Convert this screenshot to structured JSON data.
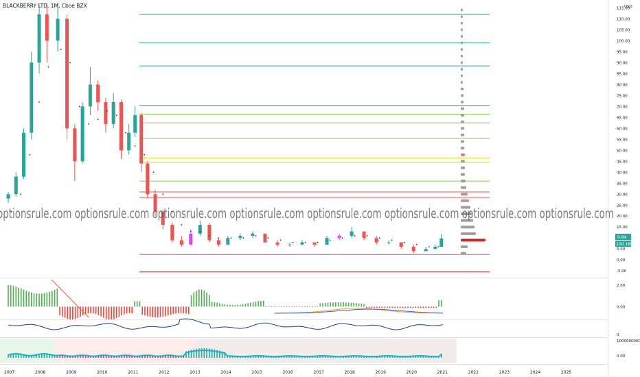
{
  "chart_data": [
    {
      "type": "candlestick",
      "title": "BLACKBERRY LTD, 1M, Cboe BZX",
      "currency": "USD",
      "ylim": [
        -6.5,
        117
      ],
      "y_ticks": [
        -5,
        0,
        5,
        10,
        15,
        20,
        25,
        30,
        35,
        40,
        45,
        50,
        55,
        60,
        65,
        70,
        75,
        80,
        85,
        90,
        95,
        100,
        105,
        110,
        115
      ],
      "x_ticks": [
        "2007",
        "2008",
        "2009",
        "2010",
        "2011",
        "2012",
        "2013",
        "2014",
        "2015",
        "2016",
        "2017",
        "2018",
        "2019",
        "2020",
        "2021",
        "2022",
        "2023",
        "2024",
        "2025"
      ],
      "watermark": "optionsrule.com optionsrule.com optionsrule.com optionsrule.com optionsrule.com optionsrule.com optionsrule.com optionsrule.com",
      "last_price": "9.84",
      "countdown": "10d 18h",
      "colors": {
        "up": "#26a69a",
        "down": "#ef5350",
        "pink": "#e040fb",
        "dots": "#333333"
      },
      "bars": [
        {
          "t": 2007.0,
          "o": 28,
          "h": 31,
          "l": 26,
          "c": 30
        },
        {
          "t": 2007.25,
          "o": 30,
          "h": 40,
          "l": 29,
          "c": 38
        },
        {
          "t": 2007.5,
          "o": 38,
          "h": 60,
          "l": 37,
          "c": 58
        },
        {
          "t": 2007.75,
          "o": 58,
          "h": 95,
          "l": 55,
          "c": 90
        },
        {
          "t": 2008.0,
          "o": 90,
          "h": 117,
          "l": 85,
          "c": 112
        },
        {
          "t": 2008.25,
          "o": 112,
          "h": 117,
          "l": 90,
          "c": 100
        },
        {
          "t": 2008.6,
          "o": 100,
          "h": 117,
          "l": 95,
          "c": 110
        },
        {
          "t": 2008.9,
          "o": 110,
          "h": 112,
          "l": 55,
          "c": 60
        },
        {
          "t": 2009.15,
          "o": 60,
          "h": 62,
          "l": 36,
          "c": 45
        },
        {
          "t": 2009.4,
          "o": 45,
          "h": 72,
          "l": 44,
          "c": 70
        },
        {
          "t": 2009.65,
          "o": 70,
          "h": 88,
          "l": 66,
          "c": 80
        },
        {
          "t": 2009.9,
          "o": 80,
          "h": 82,
          "l": 68,
          "c": 72
        },
        {
          "t": 2010.15,
          "o": 72,
          "h": 74,
          "l": 58,
          "c": 62
        },
        {
          "t": 2010.4,
          "o": 62,
          "h": 76,
          "l": 60,
          "c": 72
        },
        {
          "t": 2010.65,
          "o": 72,
          "h": 73,
          "l": 46,
          "c": 50
        },
        {
          "t": 2010.9,
          "o": 50,
          "h": 62,
          "l": 48,
          "c": 58
        },
        {
          "t": 2011.1,
          "o": 58,
          "h": 70,
          "l": 56,
          "c": 66
        },
        {
          "t": 2011.3,
          "o": 66,
          "h": 67,
          "l": 40,
          "c": 44
        },
        {
          "t": 2011.5,
          "o": 44,
          "h": 45,
          "l": 28,
          "c": 30
        },
        {
          "t": 2011.75,
          "o": 30,
          "h": 32,
          "l": 20,
          "c": 22
        },
        {
          "t": 2012.0,
          "o": 22,
          "h": 23,
          "l": 14,
          "c": 16
        },
        {
          "t": 2012.3,
          "o": 16,
          "h": 17,
          "l": 8,
          "c": 9
        },
        {
          "t": 2012.6,
          "o": 9,
          "h": 11,
          "l": 6,
          "c": 7
        },
        {
          "t": 2012.9,
          "o": 7,
          "h": 14,
          "l": 7,
          "c": 12
        },
        {
          "t": 2013.2,
          "o": 12,
          "h": 18,
          "l": 11,
          "c": 16
        },
        {
          "t": 2013.5,
          "o": 16,
          "h": 17,
          "l": 8,
          "c": 9
        },
        {
          "t": 2013.8,
          "o": 9,
          "h": 10,
          "l": 6,
          "c": 7
        },
        {
          "t": 2014.1,
          "o": 7,
          "h": 11,
          "l": 7,
          "c": 10
        },
        {
          "t": 2014.5,
          "o": 10,
          "h": 12,
          "l": 9,
          "c": 11
        },
        {
          "t": 2014.9,
          "o": 11,
          "h": 13,
          "l": 10,
          "c": 12
        },
        {
          "t": 2015.3,
          "o": 12,
          "h": 12,
          "l": 8,
          "c": 8
        },
        {
          "t": 2015.7,
          "o": 8,
          "h": 9,
          "l": 6,
          "c": 7
        },
        {
          "t": 2016.1,
          "o": 7,
          "h": 8,
          "l": 6,
          "c": 7
        },
        {
          "t": 2016.5,
          "o": 7,
          "h": 9,
          "l": 7,
          "c": 8
        },
        {
          "t": 2016.9,
          "o": 8,
          "h": 8,
          "l": 6,
          "c": 7
        },
        {
          "t": 2017.3,
          "o": 7,
          "h": 11,
          "l": 7,
          "c": 10
        },
        {
          "t": 2017.7,
          "o": 10,
          "h": 12,
          "l": 9,
          "c": 11
        },
        {
          "t": 2018.1,
          "o": 11,
          "h": 15,
          "l": 10,
          "c": 13
        },
        {
          "t": 2018.5,
          "o": 13,
          "h": 13,
          "l": 9,
          "c": 10
        },
        {
          "t": 2018.9,
          "o": 10,
          "h": 11,
          "l": 7,
          "c": 8
        },
        {
          "t": 2019.3,
          "o": 8,
          "h": 9,
          "l": 7,
          "c": 8
        },
        {
          "t": 2019.7,
          "o": 8,
          "h": 8,
          "l": 5,
          "c": 6
        },
        {
          "t": 2020.1,
          "o": 6,
          "h": 7,
          "l": 3,
          "c": 4
        },
        {
          "t": 2020.5,
          "o": 4,
          "h": 6,
          "l": 4,
          "c": 5
        },
        {
          "t": 2020.8,
          "o": 5,
          "h": 7,
          "l": 5,
          "c": 6
        },
        {
          "t": 2021.0,
          "o": 6,
          "h": 12,
          "l": 6,
          "c": 9.84
        }
      ],
      "level_lines": [
        {
          "y": 112,
          "color": "#26a69a"
        },
        {
          "y": 99,
          "color": "#26a69a"
        },
        {
          "y": 88.5,
          "color": "#26a69a"
        },
        {
          "y": 70.5,
          "color": "#26a69a"
        },
        {
          "y": 66.5,
          "color": "#8bc34a"
        },
        {
          "y": 62.5,
          "color": "#8bc34a"
        },
        {
          "y": 55.5,
          "color": "#8bc34a"
        },
        {
          "y": 46.5,
          "color": "#cddc39"
        },
        {
          "y": 44.5,
          "color": "#cddc39"
        },
        {
          "y": 36,
          "color": "#8bc34a"
        },
        {
          "y": 31,
          "color": "#ef5350"
        },
        {
          "y": 28.5,
          "color": "#ef5350"
        },
        {
          "y": 2.5,
          "color": "#ef5350"
        },
        {
          "y": -5.5,
          "color": "#b71c1c"
        }
      ],
      "volume_profile": [
        {
          "y": 114,
          "w": 3,
          "color": "#9e9e9e"
        },
        {
          "y": 111,
          "w": 3,
          "color": "#9e9e9e"
        },
        {
          "y": 108,
          "w": 3,
          "color": "#9e9e9e"
        },
        {
          "y": 105,
          "w": 3,
          "color": "#9e9e9e"
        },
        {
          "y": 102,
          "w": 3,
          "color": "#9e9e9e"
        },
        {
          "y": 99,
          "w": 3,
          "color": "#9e9e9e"
        },
        {
          "y": 96,
          "w": 3,
          "color": "#9e9e9e"
        },
        {
          "y": 93,
          "w": 3,
          "color": "#9e9e9e"
        },
        {
          "y": 90,
          "w": 3,
          "color": "#9e9e9e"
        },
        {
          "y": 87,
          "w": 3,
          "color": "#9e9e9e"
        },
        {
          "y": 84,
          "w": 3,
          "color": "#9e9e9e"
        },
        {
          "y": 81,
          "w": 3,
          "color": "#9e9e9e"
        },
        {
          "y": 78,
          "w": 4,
          "color": "#9e9e9e"
        },
        {
          "y": 75,
          "w": 4,
          "color": "#9e9e9e"
        },
        {
          "y": 72,
          "w": 4,
          "color": "#9e9e9e"
        },
        {
          "y": 69,
          "w": 5,
          "color": "#9e9e9e"
        },
        {
          "y": 66,
          "w": 5,
          "color": "#9e9e9e"
        },
        {
          "y": 63,
          "w": 5,
          "color": "#9e9e9e"
        },
        {
          "y": 60,
          "w": 5,
          "color": "#9e9e9e"
        },
        {
          "y": 57,
          "w": 5,
          "color": "#9e9e9e"
        },
        {
          "y": 54,
          "w": 5,
          "color": "#9e9e9e"
        },
        {
          "y": 51,
          "w": 5,
          "color": "#9e9e9e"
        },
        {
          "y": 48,
          "w": 6,
          "color": "#e57373"
        },
        {
          "y": 45,
          "w": 6,
          "color": "#9e9e9e"
        },
        {
          "y": 42,
          "w": 6,
          "color": "#9e9e9e"
        },
        {
          "y": 39,
          "w": 6,
          "color": "#9e9e9e"
        },
        {
          "y": 36,
          "w": 7,
          "color": "#9e9e9e"
        },
        {
          "y": 33,
          "w": 8,
          "color": "#9e9e9e"
        },
        {
          "y": 30,
          "w": 10,
          "color": "#9e9e9e"
        },
        {
          "y": 27,
          "w": 12,
          "color": "#9e9e9e"
        },
        {
          "y": 24,
          "w": 14,
          "color": "#9e9e9e"
        },
        {
          "y": 21,
          "w": 16,
          "color": "#9e9e9e"
        },
        {
          "y": 18,
          "w": 18,
          "color": "#9e9e9e"
        },
        {
          "y": 15,
          "w": 20,
          "color": "#9e9e9e"
        },
        {
          "y": 12,
          "w": 22,
          "color": "#9e9e9e"
        },
        {
          "y": 9,
          "w": 36,
          "color": "#c62828"
        },
        {
          "y": 6,
          "w": 10,
          "color": "#9e9e9e"
        },
        {
          "y": 3,
          "w": 8,
          "color": "#9e9e9e"
        }
      ]
    },
    {
      "type": "histogram",
      "ylim": [
        -1,
        2.5
      ],
      "y_ticks": [
        "2.00",
        "0.00"
      ],
      "y_tick_values": [
        2,
        0
      ]
    },
    {
      "type": "line",
      "y_ticks": [
        "0"
      ],
      "y_tick_values": [
        0
      ]
    },
    {
      "type": "line",
      "y_ticks": [
        "1000000000.00",
        "0.00"
      ]
    }
  ]
}
